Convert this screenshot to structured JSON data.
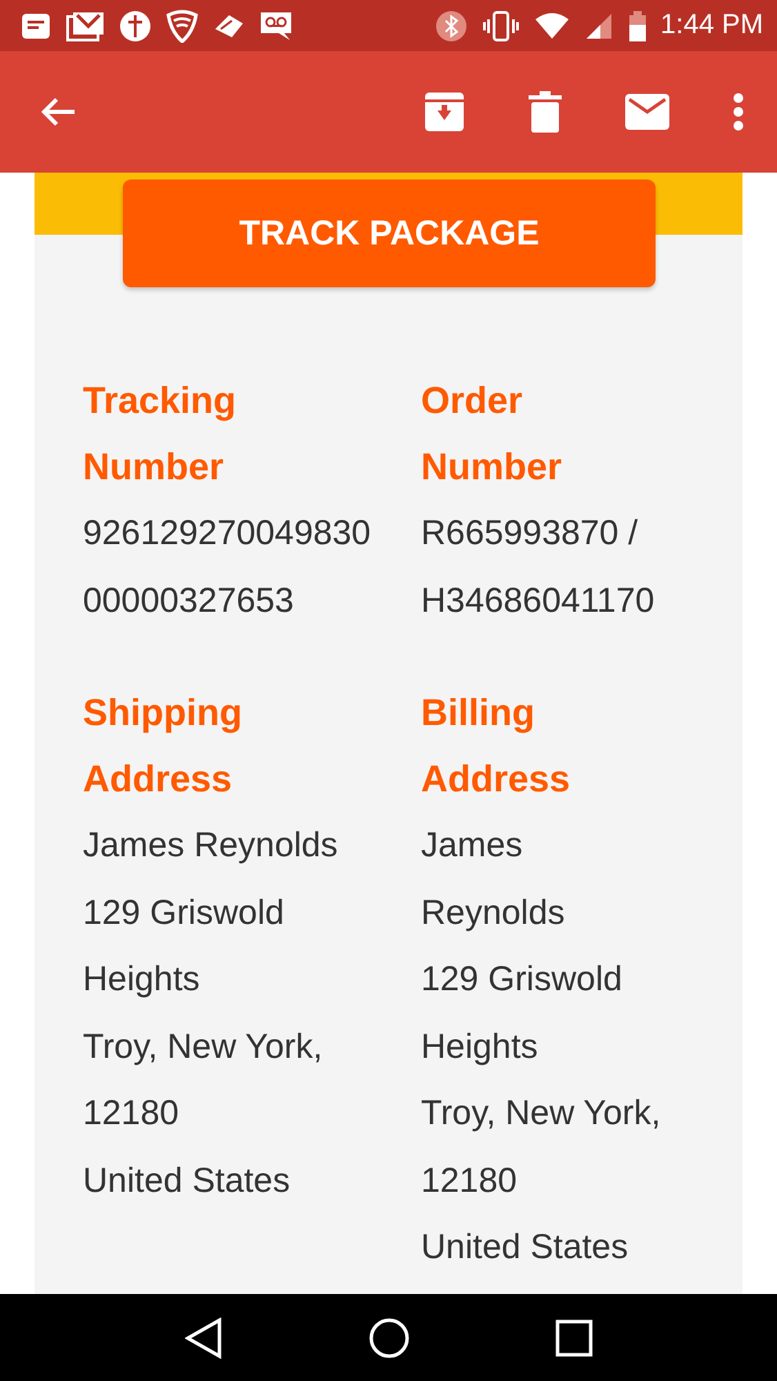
{
  "status_bar": {
    "time": "1:44 PM"
  },
  "sections": [
    {
      "heading_lines": [
        "Tracking",
        "Number"
      ],
      "lines": [
        "926129270049830",
        "00000327653"
      ]
    },
    {
      "heading_lines": [
        "Order",
        "Number"
      ],
      "lines": [
        "R665993870 /",
        "H34686041170"
      ]
    },
    {
      "heading_lines": [
        "Shipping",
        "Address"
      ],
      "lines": [
        "James Reynolds",
        "129 Griswold",
        "Heights",
        "Troy, New York,",
        "12180",
        "United States"
      ]
    },
    {
      "heading_lines": [
        "Billing",
        "Address"
      ],
      "lines": [
        "James",
        "Reynolds",
        "129 Griswold",
        "Heights",
        "Troy, New York,",
        "12180",
        "United States"
      ]
    }
  ],
  "track_button": {
    "label": "TRACK PACKAGE"
  }
}
